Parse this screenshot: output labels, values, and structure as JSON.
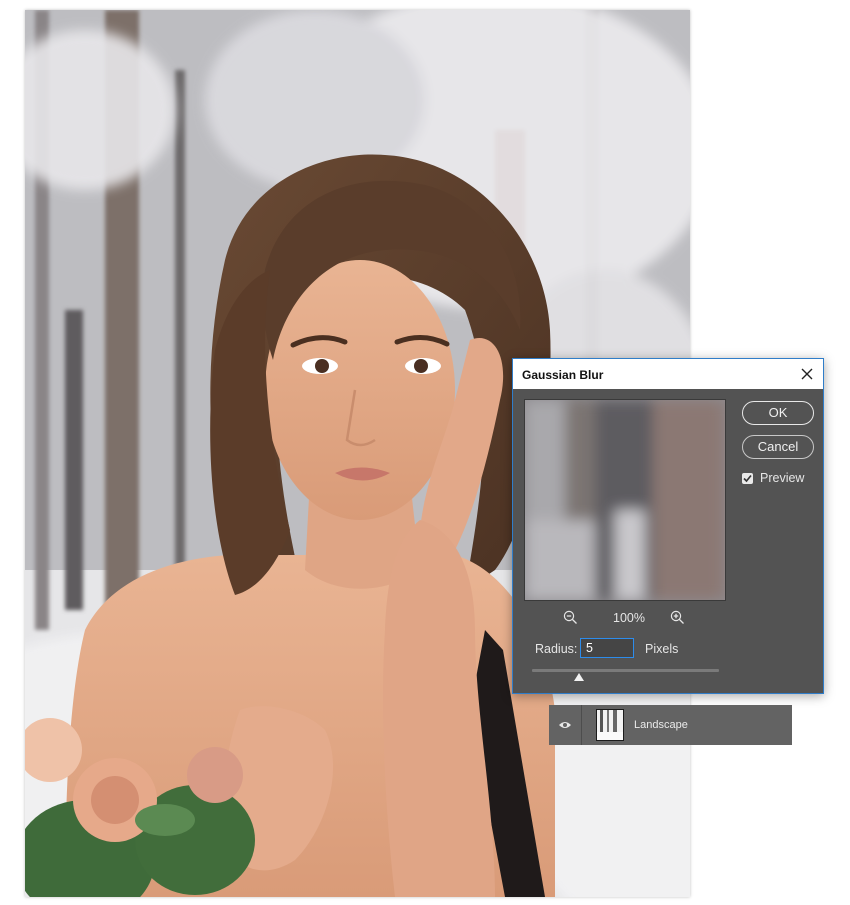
{
  "dialog": {
    "title": "Gaussian Blur",
    "ok_label": "OK",
    "cancel_label": "Cancel",
    "preview_label": "Preview",
    "preview_checked": true,
    "zoom_level": "100%",
    "radius_label": "Radius:",
    "radius_value": "5",
    "radius_unit": "Pixels",
    "radius_slider_fraction": 0.25
  },
  "layer": {
    "name": "Landscape",
    "visible": true
  },
  "icons": {
    "close": "close-icon",
    "zoom_out": "zoom-out-icon",
    "zoom_in": "zoom-in-icon",
    "eye": "eye-icon",
    "check": "check-icon"
  },
  "colors": {
    "dialog_bg": "#535353",
    "dialog_border": "#2f7dc9",
    "input_focus": "#2d8ceb",
    "layer_bg": "#636363"
  }
}
